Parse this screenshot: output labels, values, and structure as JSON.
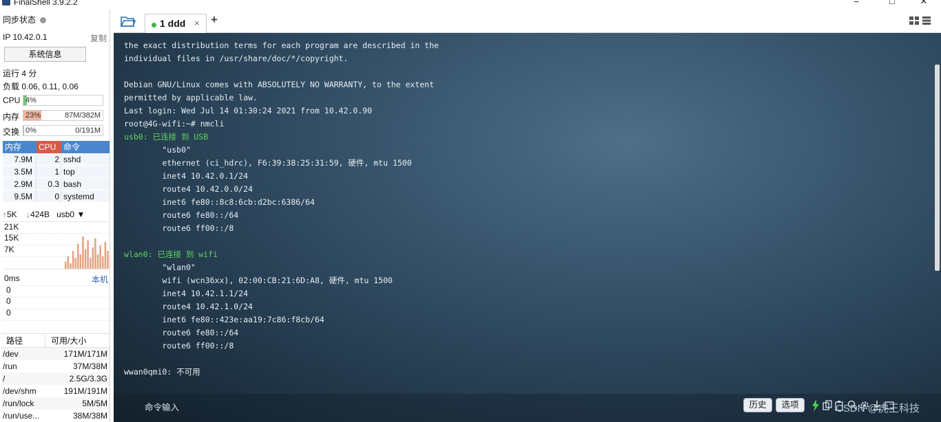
{
  "window": {
    "title": "FinalShell 3.9.2.2"
  },
  "sidebar": {
    "sync_status": "同步状态",
    "ip": "IP 10.42.0.1",
    "copy": "复制",
    "sysinfo_button": "系统信息",
    "uptime": "运行 4 分",
    "load": "负载 0.06, 0.11, 0.06",
    "meters": [
      {
        "label": "CPU",
        "pct": "4%",
        "amount": "",
        "fill": 0.04,
        "color": "#7bc47f"
      },
      {
        "label": "内存",
        "pct": "23%",
        "amount": "87M/382M",
        "fill": 0.23,
        "color": "#f0b49a"
      },
      {
        "label": "交换",
        "pct": "0%",
        "amount": "0/191M",
        "fill": 0.0,
        "color": "#7bc47f"
      }
    ],
    "process_headers": {
      "mem": "内存",
      "cpu": "CPU",
      "cmd": "命令"
    },
    "processes": [
      {
        "mem": "7.9M",
        "cpu": "2",
        "cmd": "sshd"
      },
      {
        "mem": "3.5M",
        "cpu": "1",
        "cmd": "top"
      },
      {
        "mem": "2.9M",
        "cpu": "0.3",
        "cmd": "bash"
      },
      {
        "mem": "9.5M",
        "cpu": "0",
        "cmd": "systemd"
      }
    ],
    "network": {
      "up": "5K",
      "down": "424B",
      "interface": "usb0",
      "y_labels": [
        "21K",
        "15K",
        "7K"
      ],
      "bars": [
        0.2,
        0.35,
        0.15,
        0.5,
        0.3,
        0.7,
        0.4,
        0.9,
        0.55,
        0.8,
        0.3,
        0.6,
        0.85,
        0.4,
        0.65,
        0.35,
        0.75,
        0.5,
        0.3,
        0.6
      ]
    },
    "ping": {
      "label": "0ms",
      "local": "本机",
      "values": [
        "0",
        "0",
        "0"
      ]
    },
    "disk_headers": {
      "path": "路径",
      "size": "可用/大小"
    },
    "disks": [
      {
        "path": "/dev",
        "size": "171M/171M"
      },
      {
        "path": "/run",
        "size": "37M/38M"
      },
      {
        "path": "/",
        "size": "2.5G/3.3G"
      },
      {
        "path": "/dev/shm",
        "size": "191M/191M"
      },
      {
        "path": "/run/lock",
        "size": "5M/5M"
      },
      {
        "path": "/run/use...",
        "size": "38M/38M"
      }
    ]
  },
  "tabs": {
    "active": {
      "label": "1 ddd",
      "close": "×"
    },
    "add": "+"
  },
  "terminal": {
    "lines": [
      {
        "text": "the exact distribution terms for each program are described in the",
        "green": false
      },
      {
        "text": "individual files in /usr/share/doc/*/copyright.",
        "green": false
      },
      {
        "text": "",
        "green": false
      },
      {
        "text": "Debian GNU/Linux comes with ABSOLUTELY NO WARRANTY, to the extent",
        "green": false
      },
      {
        "text": "permitted by applicable law.",
        "green": false
      },
      {
        "text": "Last login: Wed Jul 14 01:30:24 2021 from 10.42.0.90",
        "green": false
      },
      {
        "text": "root@4G-wifi:~# nmcli",
        "green": false
      },
      {
        "text": "usb0: 已连接 到 USB",
        "green": true
      },
      {
        "text": "        \"usb0\"",
        "green": false
      },
      {
        "text": "        ethernet (ci_hdrc), F6:39:38:25:31:59, 硬件, mtu 1500",
        "green": false
      },
      {
        "text": "        inet4 10.42.0.1/24",
        "green": false
      },
      {
        "text": "        route4 10.42.0.0/24",
        "green": false
      },
      {
        "text": "        inet6 fe80::8c8:6cb:d2bc:6386/64",
        "green": false
      },
      {
        "text": "        route6 fe80::/64",
        "green": false
      },
      {
        "text": "        route6 ff00::/8",
        "green": false
      },
      {
        "text": "",
        "green": false
      },
      {
        "text": "wlan0: 已连接 到 wifi",
        "green": true
      },
      {
        "text": "        \"wlan0\"",
        "green": false
      },
      {
        "text": "        wifi (wcn36xx), 02:00:CB:21:6D:A8, 硬件, mtu 1500",
        "green": false
      },
      {
        "text": "        inet4 10.42.1.1/24",
        "green": false
      },
      {
        "text": "        route4 10.42.1.0/24",
        "green": false
      },
      {
        "text": "        inet6 fe80::423e:aa19:7c86:f8cb/64",
        "green": false
      },
      {
        "text": "        route6 fe80::/64",
        "green": false
      },
      {
        "text": "        route6 ff00::/8",
        "green": false
      },
      {
        "text": "",
        "green": false
      },
      {
        "text": "wwan0qmi0: 不可用",
        "green": false
      }
    ]
  },
  "command_bar": {
    "label": "命令输入",
    "history": "历史",
    "options": "选项",
    "watermark": "CSDN @虎王科技"
  }
}
